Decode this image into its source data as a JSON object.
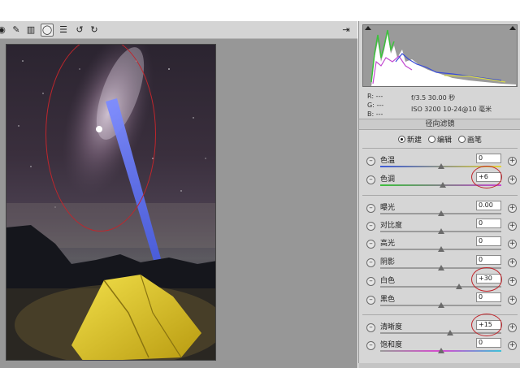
{
  "toolbar": {
    "tools": [
      {
        "icon": "eye-icon",
        "glyph": "◉"
      },
      {
        "icon": "brush-icon",
        "glyph": "✎"
      },
      {
        "icon": "graduated-filter-icon",
        "glyph": "▥"
      },
      {
        "icon": "radial-filter-icon",
        "glyph": "◯"
      },
      {
        "icon": "preferences-icon",
        "glyph": "☰"
      },
      {
        "icon": "rotate-left-icon",
        "glyph": "↺"
      },
      {
        "icon": "rotate-right-icon",
        "glyph": "↻"
      }
    ],
    "active_tool": "radial-filter-icon",
    "fullscreen_glyph": "⇥"
  },
  "info": {
    "r": "R:  ---",
    "g": "G:  ---",
    "b": "B:  ---",
    "aperture_shutter": "f/3.5   30.00 秒",
    "iso_lens": "ISO 3200   10-24@10 毫米"
  },
  "panel": {
    "title": "径向滤镜",
    "modes": [
      {
        "label": "新建",
        "selected": true
      },
      {
        "label": "编辑",
        "selected": false
      },
      {
        "label": "画笔",
        "selected": false
      }
    ]
  },
  "sliders": [
    {
      "label": "色温",
      "value": "0",
      "level": 0.5,
      "track": "temp"
    },
    {
      "label": "色调",
      "value": "+6",
      "level": 0.52,
      "track": "tint"
    },
    {
      "label": "曝光",
      "value": "0.00",
      "level": 0.5,
      "track": "gray"
    },
    {
      "label": "对比度",
      "value": "0",
      "level": 0.5,
      "track": "gray"
    },
    {
      "label": "高光",
      "value": "0",
      "level": 0.5,
      "track": "gray"
    },
    {
      "label": "阴影",
      "value": "0",
      "level": 0.5,
      "track": "gray"
    },
    {
      "label": "白色",
      "value": "+30",
      "level": 0.65,
      "track": "gray"
    },
    {
      "label": "黑色",
      "value": "0",
      "level": 0.5,
      "track": "gray"
    },
    {
      "label": "清晰度",
      "value": "+15",
      "level": 0.575,
      "track": "gray"
    },
    {
      "label": "饱和度",
      "value": "0",
      "level": 0.5,
      "track": "sat"
    }
  ],
  "colors": {
    "annotation": "#c0262c",
    "tent": "#d9c21e",
    "beam": "#5a6ff0"
  }
}
